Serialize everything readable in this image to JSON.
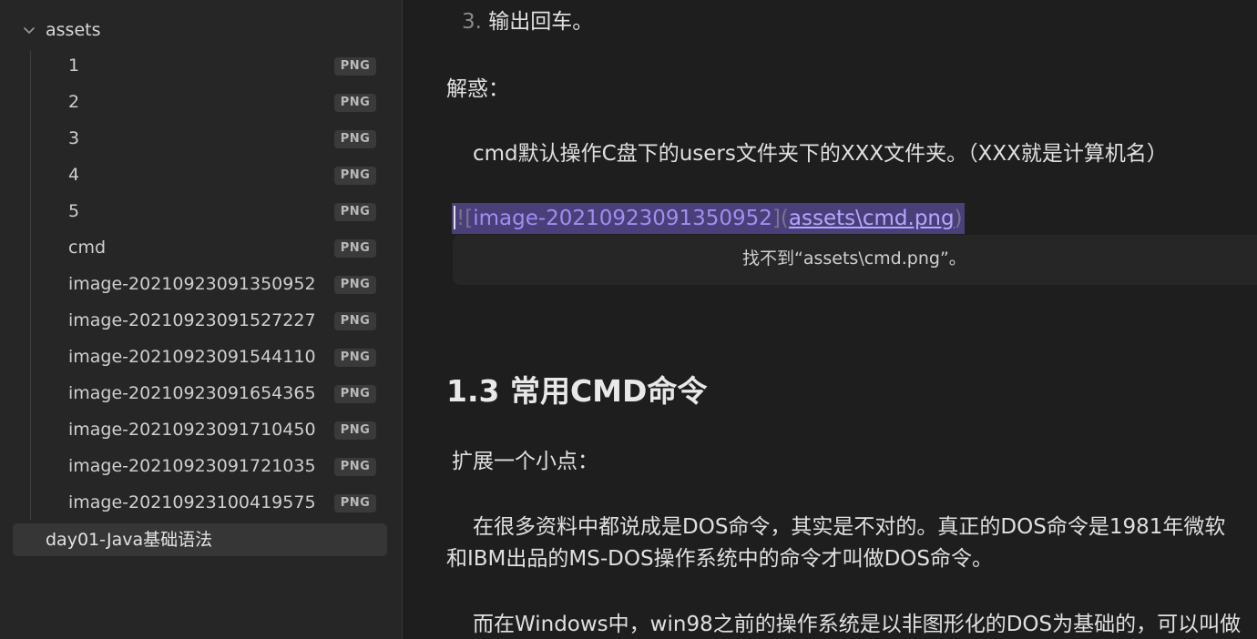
{
  "sidebar": {
    "folder": {
      "label": "assets",
      "icon": "chevron-down-icon"
    },
    "files": [
      {
        "name": "1",
        "ext": "PNG"
      },
      {
        "name": "2",
        "ext": "PNG"
      },
      {
        "name": "3",
        "ext": "PNG"
      },
      {
        "name": "4",
        "ext": "PNG"
      },
      {
        "name": "5",
        "ext": "PNG"
      },
      {
        "name": "cmd",
        "ext": "PNG"
      },
      {
        "name": "image-20210923091350952",
        "ext": "PNG"
      },
      {
        "name": "image-20210923091527227",
        "ext": "PNG"
      },
      {
        "name": "image-20210923091544110",
        "ext": "PNG"
      },
      {
        "name": "image-20210923091654365",
        "ext": "PNG"
      },
      {
        "name": "image-20210923091710450",
        "ext": "PNG"
      },
      {
        "name": "image-20210923091721035",
        "ext": "PNG"
      },
      {
        "name": "image-20210923100419575",
        "ext": "PNG"
      }
    ],
    "active_note": "day01-Java基础语法"
  },
  "editor": {
    "list_item_num": "3.",
    "list_item_text": "输出回车。",
    "label_jiehuo": "解惑：",
    "para_cmd": "cmd默认操作C盘下的users文件夹下的XXX文件夹。（XXX就是计算机名）",
    "image_link": {
      "bang": "!",
      "open_bracket": "[",
      "alt": "image-20210923091350952",
      "close_bracket": "]",
      "open_paren": "(",
      "url": "assets\\cmd.png",
      "close_paren": ")"
    },
    "image_error": "找不到“assets\\cmd.png”。",
    "heading": "1.3 常用CMD命令",
    "label_extend": "扩展一个小点：",
    "para_dos_1": "在很多资料中都说成是DOS命令，其实是不对的。真正的DOS命令是1981年微软",
    "para_dos_2": "和IBM出品的MS-DOS操作系统中的命令才叫做DOS命令。",
    "para_windows": "而在Windows中，win98之前的操作系统是以非图形化的DOS为基础的，可以叫做"
  },
  "colors": {
    "background": "#1e1e1e",
    "sidebar": "#262626",
    "selection": "#4a3f78",
    "link": "#b4a8ff",
    "active_row": "#363636"
  }
}
